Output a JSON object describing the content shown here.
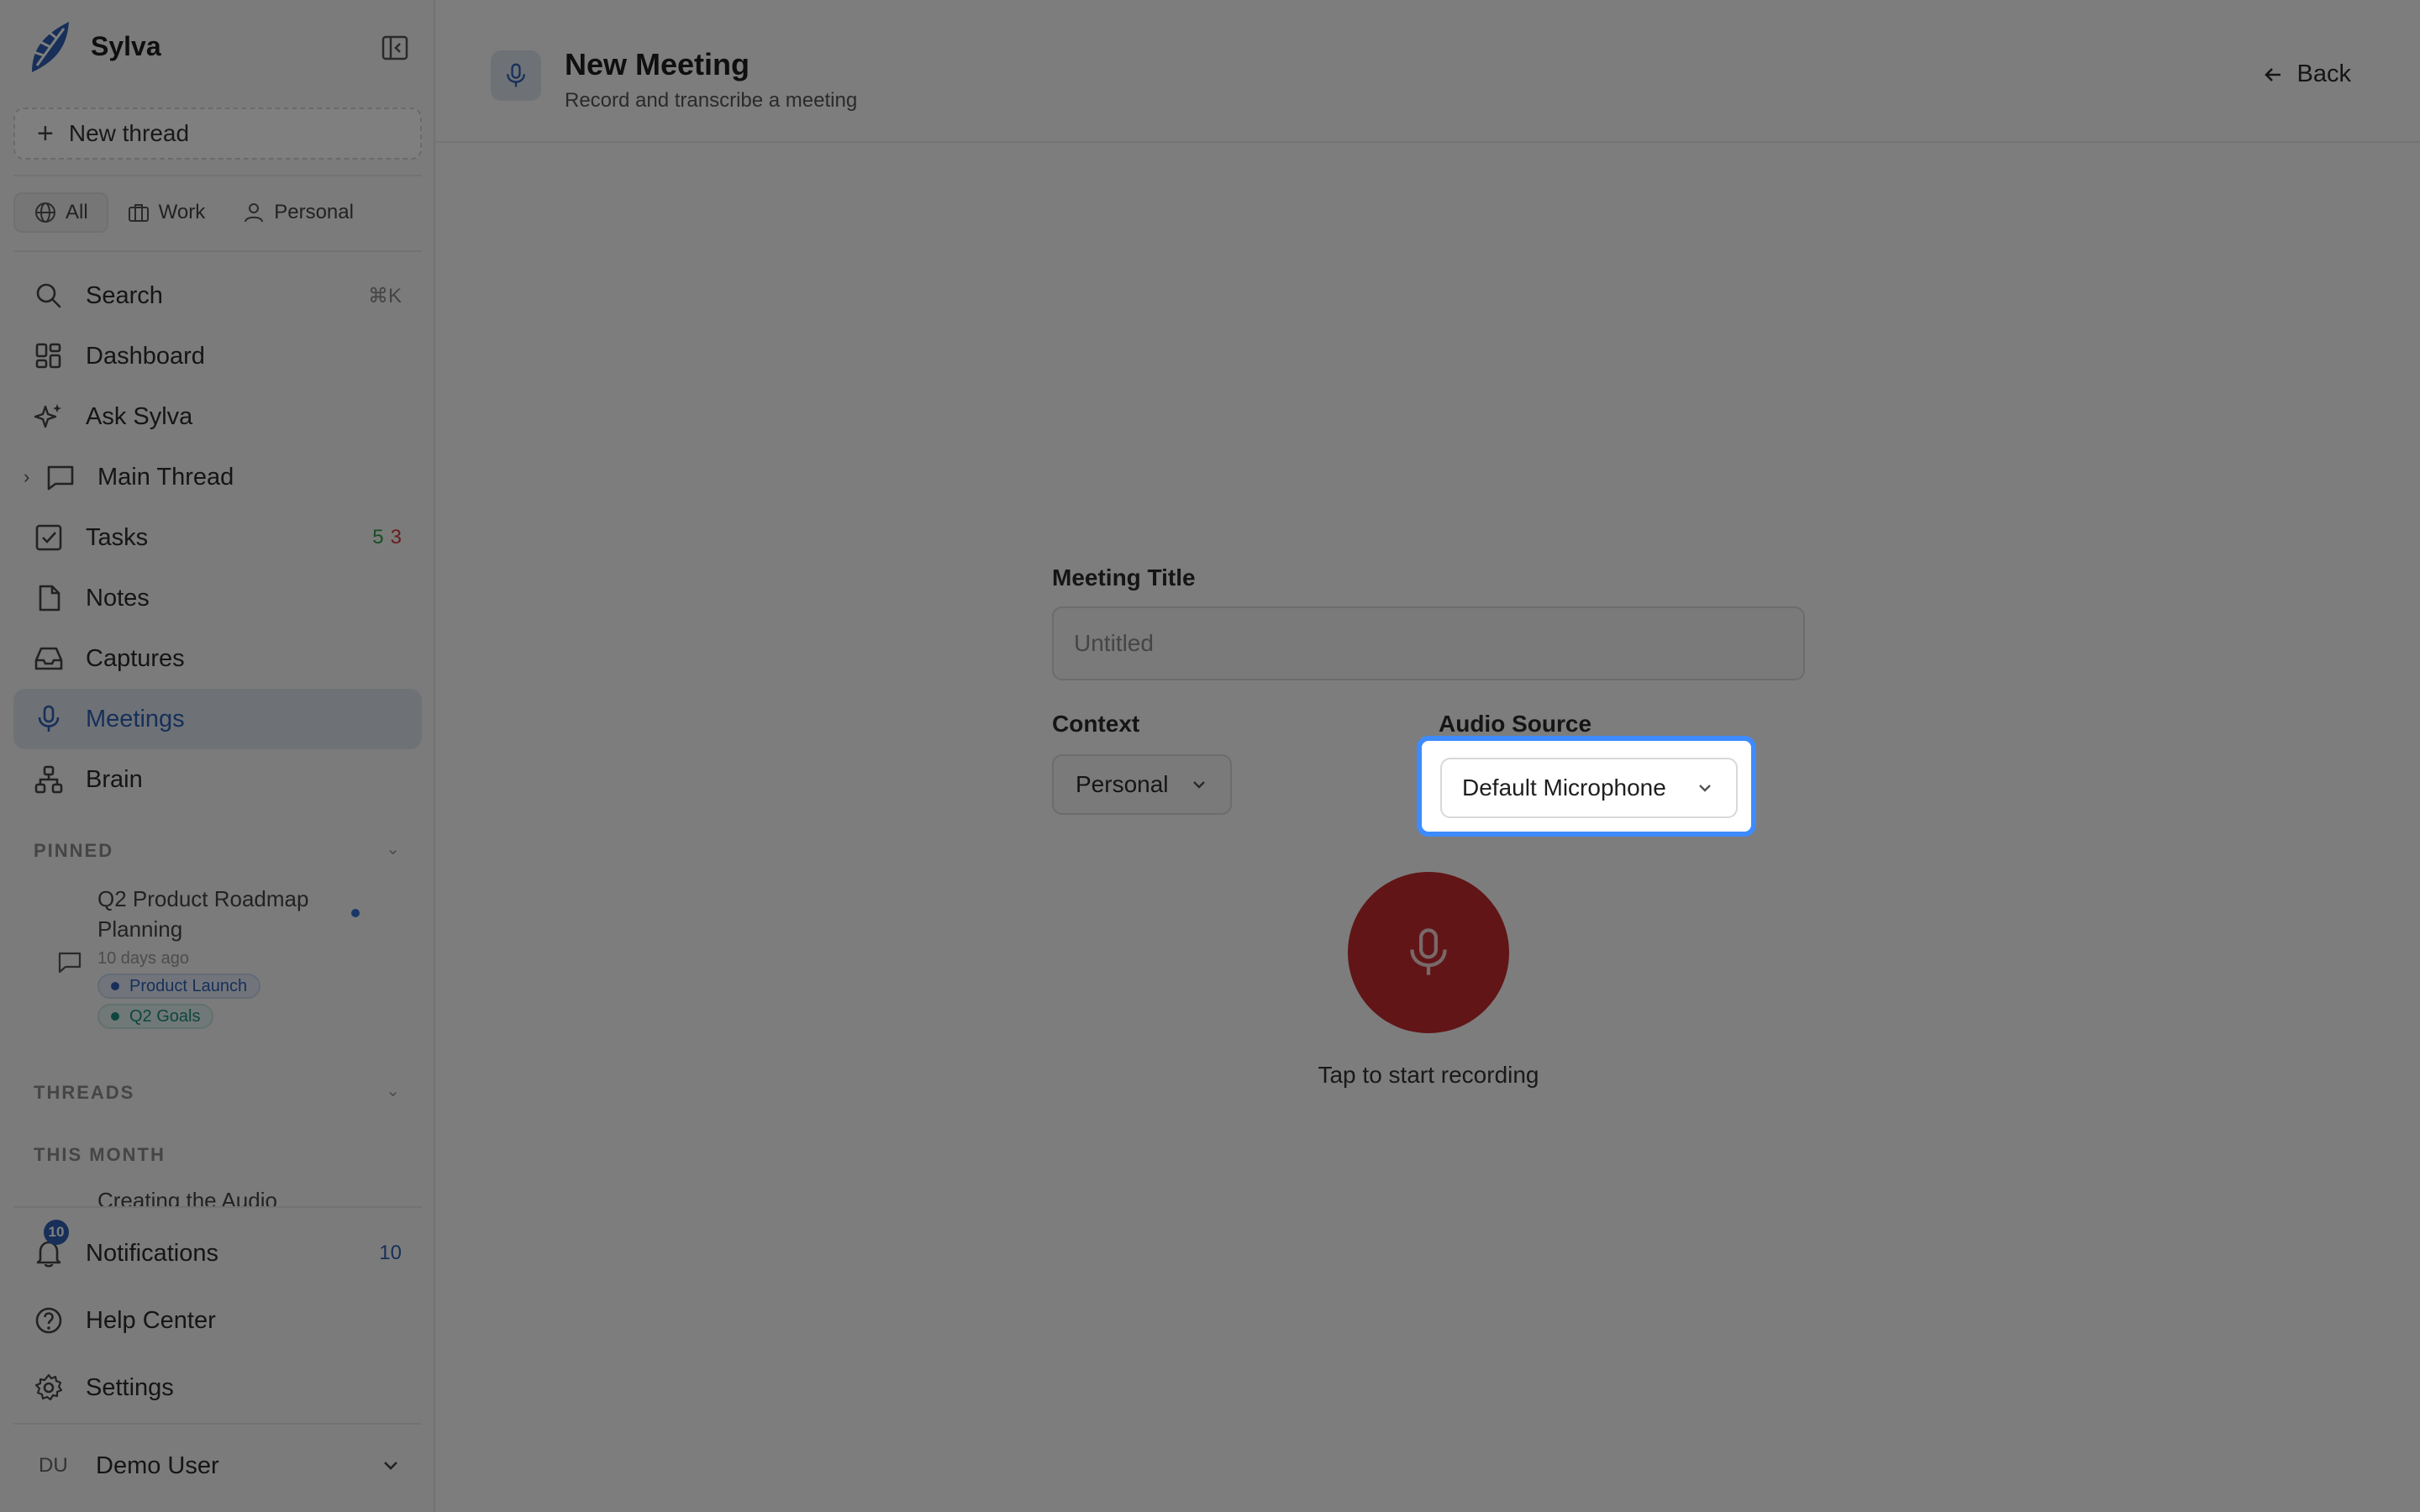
{
  "app": {
    "name": "Sylva"
  },
  "sidebar": {
    "new_thread_label": "New thread",
    "context_tabs": [
      {
        "label": "All"
      },
      {
        "label": "Work"
      },
      {
        "label": "Personal"
      }
    ],
    "search": {
      "label": "Search",
      "shortcut": "⌘K"
    },
    "items": [
      {
        "label": "Dashboard"
      },
      {
        "label": "Ask Sylva"
      },
      {
        "label": "Main Thread"
      },
      {
        "label": "Tasks",
        "count_green": "5",
        "count_red": "3"
      },
      {
        "label": "Notes"
      },
      {
        "label": "Captures"
      },
      {
        "label": "Meetings"
      },
      {
        "label": "Brain"
      }
    ],
    "pinned_label": "PINNED",
    "pinned_item": {
      "title": "Q2 Product Roadmap Planning",
      "time": "10 days ago",
      "tags": [
        "Product Launch",
        "Q2 Goals"
      ]
    },
    "threads_label": "THREADS",
    "this_month_label": "THIS MONTH",
    "thread_cut": "Creating the Audio",
    "notifications": {
      "label": "Notifications",
      "badge": "10",
      "count": "10"
    },
    "help_label": "Help Center",
    "settings_label": "Settings",
    "user": {
      "initials": "DU",
      "name": "Demo User"
    }
  },
  "header": {
    "title": "New Meeting",
    "subtitle": "Record and transcribe a meeting",
    "back_label": "Back"
  },
  "form": {
    "title_label": "Meeting Title",
    "title_placeholder": "Untitled",
    "context_label": "Context",
    "context_value": "Personal",
    "audio_label": "Audio Source",
    "audio_value": "Default Microphone",
    "record_caption": "Tap to start recording"
  },
  "colors": {
    "accent": "#2f5fb3",
    "record": "#c32a2f",
    "focus_ring": "#3d8bff"
  }
}
